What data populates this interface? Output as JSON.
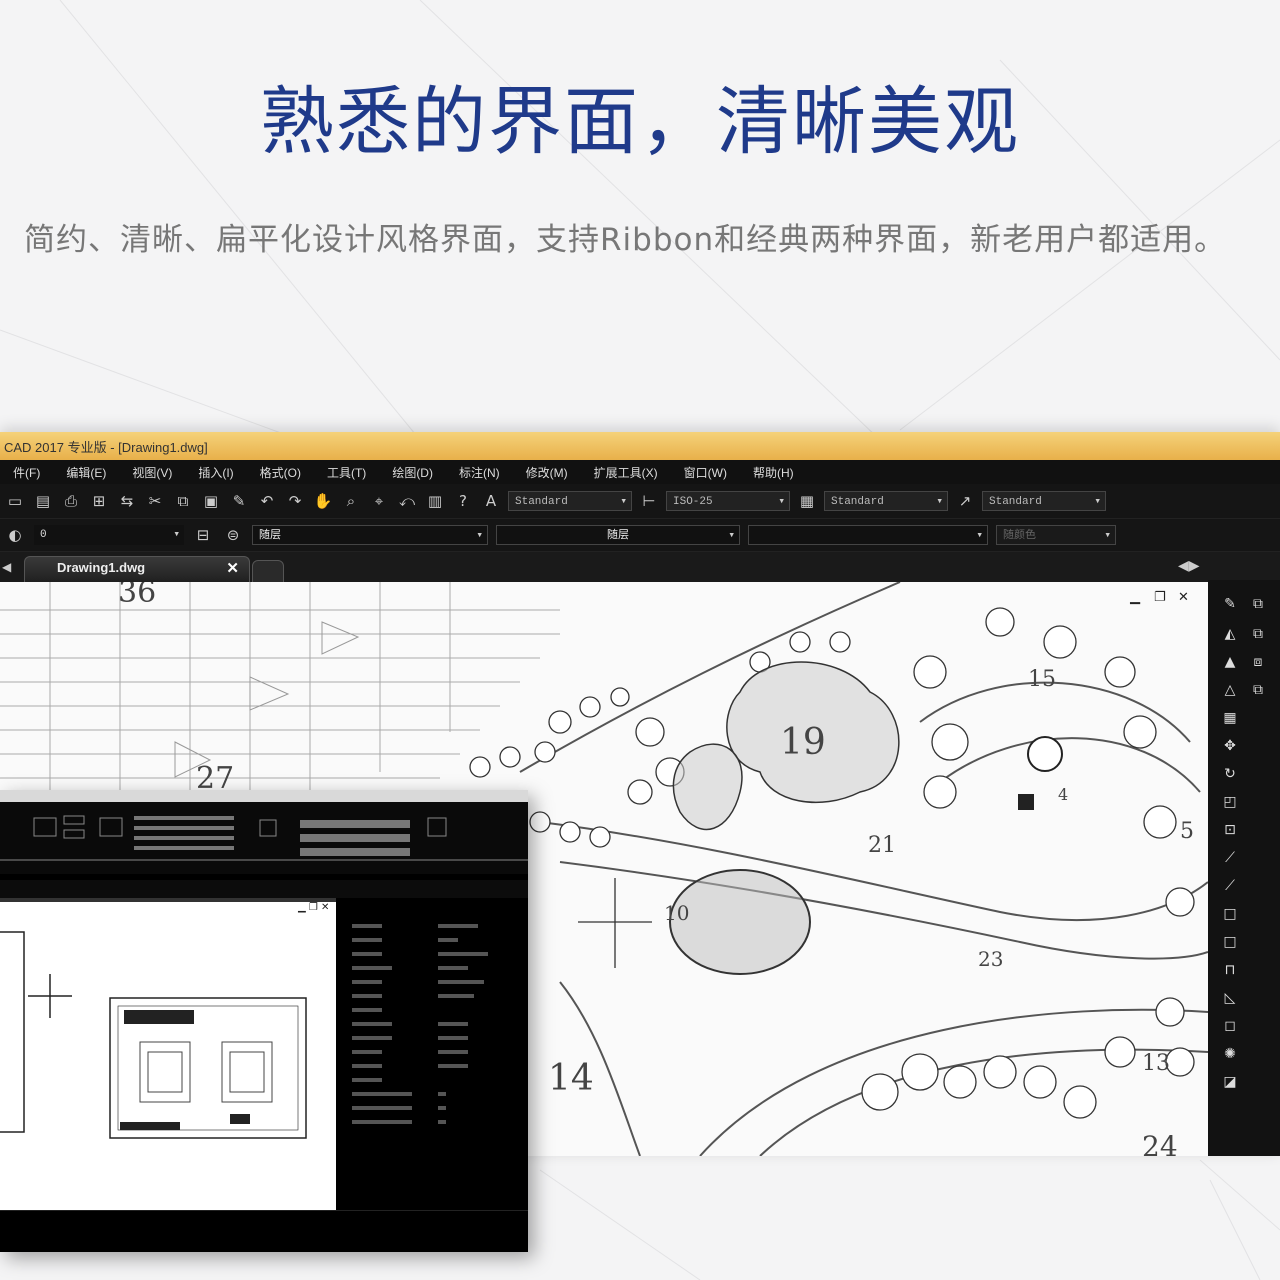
{
  "headline": "熟悉的界面，清晰美观",
  "subline": "简约、清晰、扁平化设计风格界面，支持Ribbon和经典两种界面，新老用户都适用。",
  "cad_window": {
    "title": "CAD 2017 专业版 - [Drawing1.dwg]",
    "menu": [
      "件(F)",
      "编辑(E)",
      "视图(V)",
      "插入(I)",
      "格式(O)",
      "工具(T)",
      "绘图(D)",
      "标注(N)",
      "修改(M)",
      "扩展工具(X)",
      "窗口(W)",
      "帮助(H)"
    ],
    "text_style": "Standard",
    "dim_style": "ISO-25",
    "table_style": "Standard",
    "mleader_style": "Standard",
    "layer_value": "0",
    "color_value": "随层",
    "linetype_value": "随层",
    "plot_value": "随颜色",
    "tab_label": "Drawing1.dwg",
    "tab_close": "✕",
    "drawing_labels": [
      "36",
      "27",
      "19",
      "15",
      "21",
      "10",
      "23",
      "14",
      "13",
      "24",
      "5",
      "4"
    ]
  },
  "colors": {
    "headline": "#1f3a8a",
    "title_bar": "#f5d27a",
    "app_dark": "#111111"
  },
  "icons": [
    "undo-icon",
    "redo-icon",
    "pan-icon",
    "zoom-icon",
    "help-icon",
    "line-icon",
    "circle-icon",
    "move-icon",
    "rotate-icon",
    "square-icon",
    "close-icon",
    "restore-icon",
    "minimize-icon"
  ]
}
